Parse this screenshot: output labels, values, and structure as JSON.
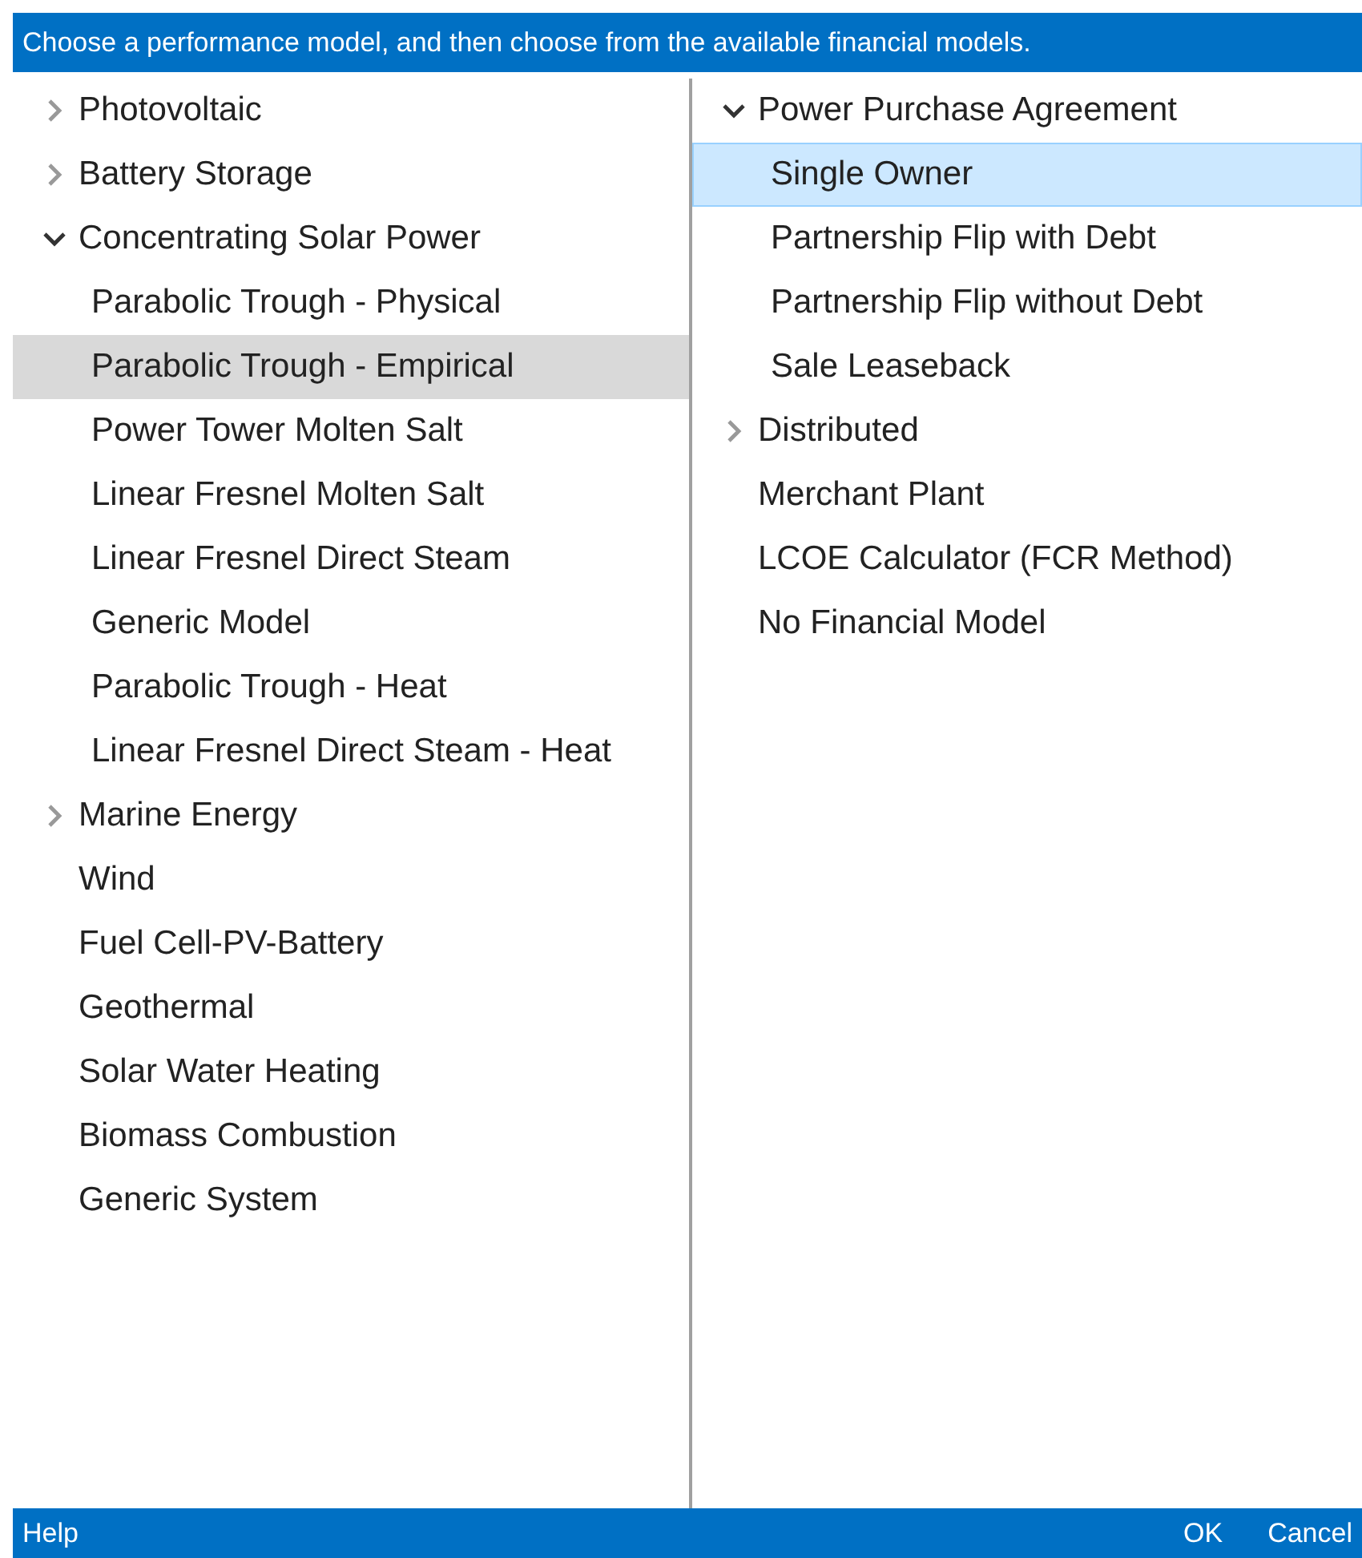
{
  "header": {
    "instruction": "Choose a performance model, and then choose from the available financial models."
  },
  "performance_models": [
    {
      "label": "Photovoltaic",
      "expanded": false,
      "selected": false
    },
    {
      "label": "Battery Storage",
      "expanded": false,
      "selected": false
    },
    {
      "label": "Concentrating Solar Power",
      "expanded": true,
      "selected": false,
      "children": [
        {
          "label": "Parabolic Trough - Physical",
          "selected": false
        },
        {
          "label": "Parabolic Trough - Empirical",
          "selected": true
        },
        {
          "label": "Power Tower Molten Salt",
          "selected": false
        },
        {
          "label": "Linear Fresnel Molten Salt",
          "selected": false
        },
        {
          "label": "Linear Fresnel Direct Steam",
          "selected": false
        },
        {
          "label": "Generic Model",
          "selected": false
        },
        {
          "label": "Parabolic Trough - Heat",
          "selected": false
        },
        {
          "label": "Linear Fresnel Direct Steam - Heat",
          "selected": false
        }
      ]
    },
    {
      "label": "Marine Energy",
      "expanded": false,
      "selected": false
    },
    {
      "label": "Wind",
      "selected": false
    },
    {
      "label": "Fuel Cell-PV-Battery",
      "selected": false
    },
    {
      "label": "Geothermal",
      "selected": false
    },
    {
      "label": "Solar Water Heating",
      "selected": false
    },
    {
      "label": "Biomass Combustion",
      "selected": false
    },
    {
      "label": "Generic System",
      "selected": false
    }
  ],
  "financial_models": [
    {
      "label": "Power Purchase Agreement",
      "expanded": true,
      "selected": false,
      "children": [
        {
          "label": "Single Owner",
          "selected": true
        },
        {
          "label": "Partnership Flip with Debt",
          "selected": false
        },
        {
          "label": "Partnership Flip without Debt",
          "selected": false
        },
        {
          "label": "Sale Leaseback",
          "selected": false
        }
      ]
    },
    {
      "label": "Distributed",
      "expanded": false,
      "selected": false
    },
    {
      "label": "Merchant Plant",
      "selected": false
    },
    {
      "label": "LCOE Calculator (FCR Method)",
      "selected": false
    },
    {
      "label": "No Financial Model",
      "selected": false
    }
  ],
  "footer": {
    "help": "Help",
    "ok": "OK",
    "cancel": "Cancel"
  }
}
